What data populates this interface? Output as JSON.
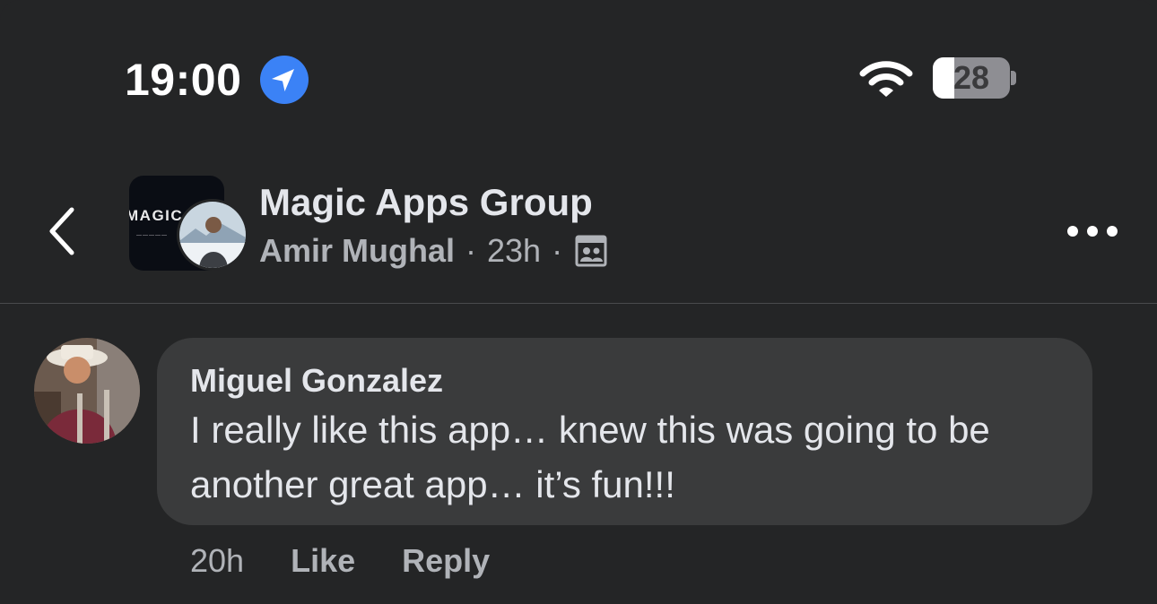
{
  "status_bar": {
    "time": "19:00",
    "location_icon": "location-arrow-icon",
    "wifi_icon": "wifi-icon",
    "battery_level": "28",
    "battery_fraction": 0.28
  },
  "header": {
    "back_icon": "chevron-left-icon",
    "group_name": "Magic Apps Group",
    "group_avatar_text": "MAGIC",
    "author": "Amir Mughal",
    "separator": "·",
    "time_ago": "23h",
    "visibility_icon": "group-members-icon",
    "more_icon": "more-horizontal-icon"
  },
  "comment": {
    "author": "Miguel Gonzalez",
    "text": "I really like this app… knew this was going to be another great app… it’s fun!!!",
    "time_ago": "20h",
    "like_label": "Like",
    "reply_label": "Reply"
  },
  "colors": {
    "background": "#242526",
    "bubble": "#3a3b3c",
    "primary_text": "#e4e6eb",
    "secondary_text": "#b0b3b8",
    "location_blue": "#3b82f6"
  }
}
